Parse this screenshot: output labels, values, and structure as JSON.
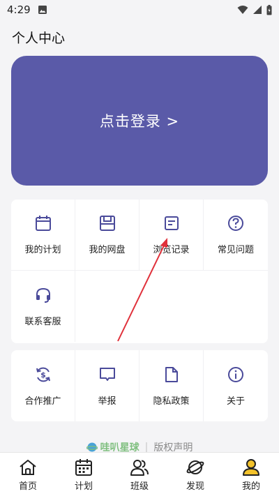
{
  "status_bar": {
    "time": "4:29"
  },
  "page_title": "个人中心",
  "login_banner": {
    "label": "点击登录 >",
    "color": "#5a5aa8"
  },
  "menu_card_1": [
    {
      "icon": "calendar-icon",
      "label": "我的计划"
    },
    {
      "icon": "disk-icon",
      "label": "我的网盘"
    },
    {
      "icon": "document-icon",
      "label": "浏览记录"
    },
    {
      "icon": "question-icon",
      "label": "常见问题"
    },
    {
      "icon": "headset-icon",
      "label": "联系客服"
    }
  ],
  "menu_card_2": [
    {
      "icon": "refresh-dollar-icon",
      "label": "合作推广"
    },
    {
      "icon": "report-icon",
      "label": "举报"
    },
    {
      "icon": "file-icon",
      "label": "隐私政策"
    },
    {
      "icon": "info-icon",
      "label": "关于"
    }
  ],
  "footer": {
    "brand": "哇叭星球",
    "link": "版权声明"
  },
  "bottom_nav": [
    {
      "icon": "home-icon",
      "label": "首页"
    },
    {
      "icon": "schedule-icon",
      "label": "计划"
    },
    {
      "icon": "class-icon",
      "label": "班级"
    },
    {
      "icon": "planet-icon",
      "label": "发现"
    },
    {
      "icon": "profile-icon",
      "label": "我的",
      "active": true
    }
  ],
  "colors": {
    "accent": "#5a5aa8",
    "icon": "#4a4a9a",
    "annotation": "#e0303a",
    "active_profile": "#f3c22b"
  }
}
